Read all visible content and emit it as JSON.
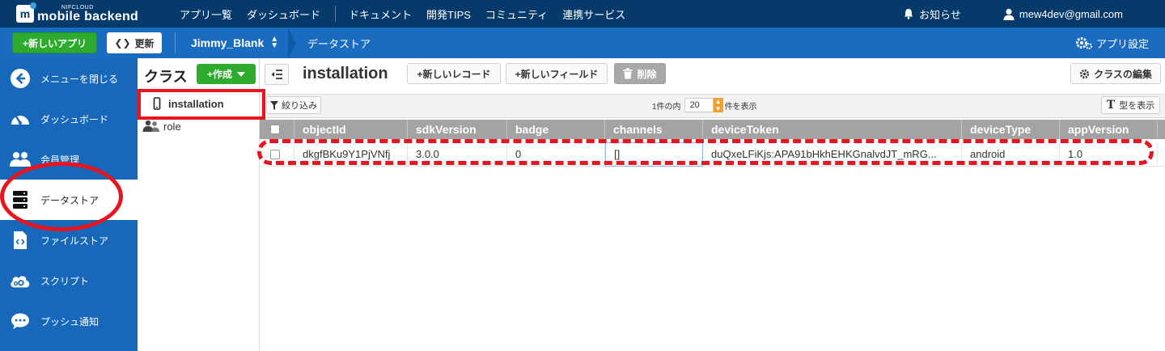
{
  "topnav": {
    "logo_small": "NIFCLOUD",
    "logo_main": "mobile backend",
    "logo_letter": "m",
    "menu": [
      "アプリ一覧",
      "ダッシュボード",
      "ドキュメント",
      "開発TIPS",
      "コミュニティ",
      "連携サービス"
    ],
    "notifications": "お知らせ",
    "user": "mew4dev@gmail.com"
  },
  "subbar": {
    "new_app": "+新しいアプリ",
    "refresh": "更新",
    "refresh_icon": "❮❯",
    "app_name": "Jimmy_Blank",
    "breadcrumb": "データストア",
    "settings": "アプリ設定"
  },
  "sidebar": {
    "items": [
      {
        "label": "メニューを閉じる",
        "icon": "arrow-left-icon"
      },
      {
        "label": "ダッシュボード",
        "icon": "gauge-icon"
      },
      {
        "label": "会員管理",
        "icon": "users-icon"
      },
      {
        "label": "データストア",
        "icon": "database-icon",
        "active": true
      },
      {
        "label": "ファイルストア",
        "icon": "file-code-icon"
      },
      {
        "label": "スクリプト",
        "icon": "cloud-gear-icon"
      },
      {
        "label": "プッシュ通知",
        "icon": "chat-bubble-icon"
      }
    ]
  },
  "classpanel": {
    "title": "クラス",
    "create": "+作成",
    "classes": [
      {
        "name": "installation",
        "icon": "mobile-icon",
        "selected": true
      },
      {
        "name": "role",
        "icon": "users-icon"
      }
    ]
  },
  "main": {
    "class_name": "installation",
    "new_record": "+新しいレコード",
    "new_field": "+新しいフィールド",
    "delete": "削除",
    "edit_class": "クラスの編集",
    "filter": "絞り込み",
    "paging_prefix": "1件の内",
    "paging_count": "20",
    "paging_suffix": "件を表示",
    "show_types": "型を表示",
    "type_glyph": "T"
  },
  "table": {
    "columns": [
      "objectId",
      "sdkVersion",
      "badge",
      "channels",
      "deviceToken",
      "deviceType",
      "appVersion"
    ],
    "rows": [
      [
        "dkgfBKu9Y1PjVNfj",
        "3.0.0",
        "0",
        "[]",
        "duQxeLFiKjs:APA91bHkhEHKGnalvdJT_mRG...",
        "android",
        "1.0"
      ]
    ]
  },
  "colors": {
    "topnav": "#063a6b",
    "subbar": "#1a6cc0",
    "sidebar": "#1767bb",
    "green": "#2dab2d",
    "highlight_red": "#e8141e"
  }
}
